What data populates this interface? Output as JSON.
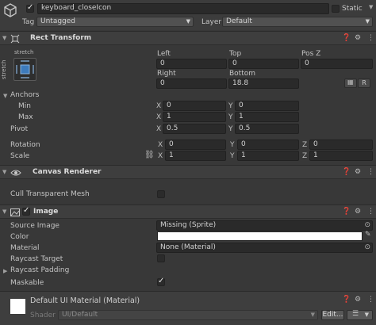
{
  "gameobject": {
    "name": "keyboard_closeIcon",
    "static_label": "Static",
    "tag_label": "Tag",
    "tag_value": "Untagged",
    "layer_label": "Layer",
    "layer_value": "Default"
  },
  "rect_transform": {
    "title": "Rect Transform",
    "anchor_preset_label_h": "stretch",
    "anchor_preset_label_v": "stretch",
    "left_label": "Left",
    "top_label": "Top",
    "posz_label": "Pos Z",
    "left": "0",
    "top": "0",
    "posz": "0",
    "right_label": "Right",
    "bottom_label": "Bottom",
    "right": "0",
    "bottom": "18.8",
    "r_button": "R",
    "anchors_label": "Anchors",
    "min_label": "Min",
    "max_label": "Max",
    "min_x": "0",
    "min_y": "0",
    "max_x": "1",
    "max_y": "1",
    "pivot_label": "Pivot",
    "pivot_x": "0.5",
    "pivot_y": "0.5",
    "rotation_label": "Rotation",
    "rot_x": "0",
    "rot_y": "0",
    "rot_z": "0",
    "scale_label": "Scale",
    "scale_x": "1",
    "scale_y": "1",
    "scale_z": "1",
    "x": "X",
    "y": "Y",
    "z": "Z"
  },
  "canvas_renderer": {
    "title": "Canvas Renderer",
    "cull_label": "Cull Transparent Mesh"
  },
  "image": {
    "title": "Image",
    "source_label": "Source Image",
    "source_value": "Missing (Sprite)",
    "color_label": "Color",
    "material_label": "Material",
    "material_value": "None (Material)",
    "raycast_target_label": "Raycast Target",
    "raycast_padding_label": "Raycast Padding",
    "maskable_label": "Maskable"
  },
  "material": {
    "title": "Default UI Material (Material)",
    "shader_label": "Shader",
    "shader_value": "UI/Default",
    "edit_button": "Edit..."
  },
  "icons": [
    "cube-icon",
    "rect-transform-icon",
    "eye-icon",
    "image-icon",
    "help-icon",
    "sliders-icon",
    "kebab-menu-icon",
    "link-icon",
    "object-picker-icon",
    "eyedropper-icon"
  ]
}
